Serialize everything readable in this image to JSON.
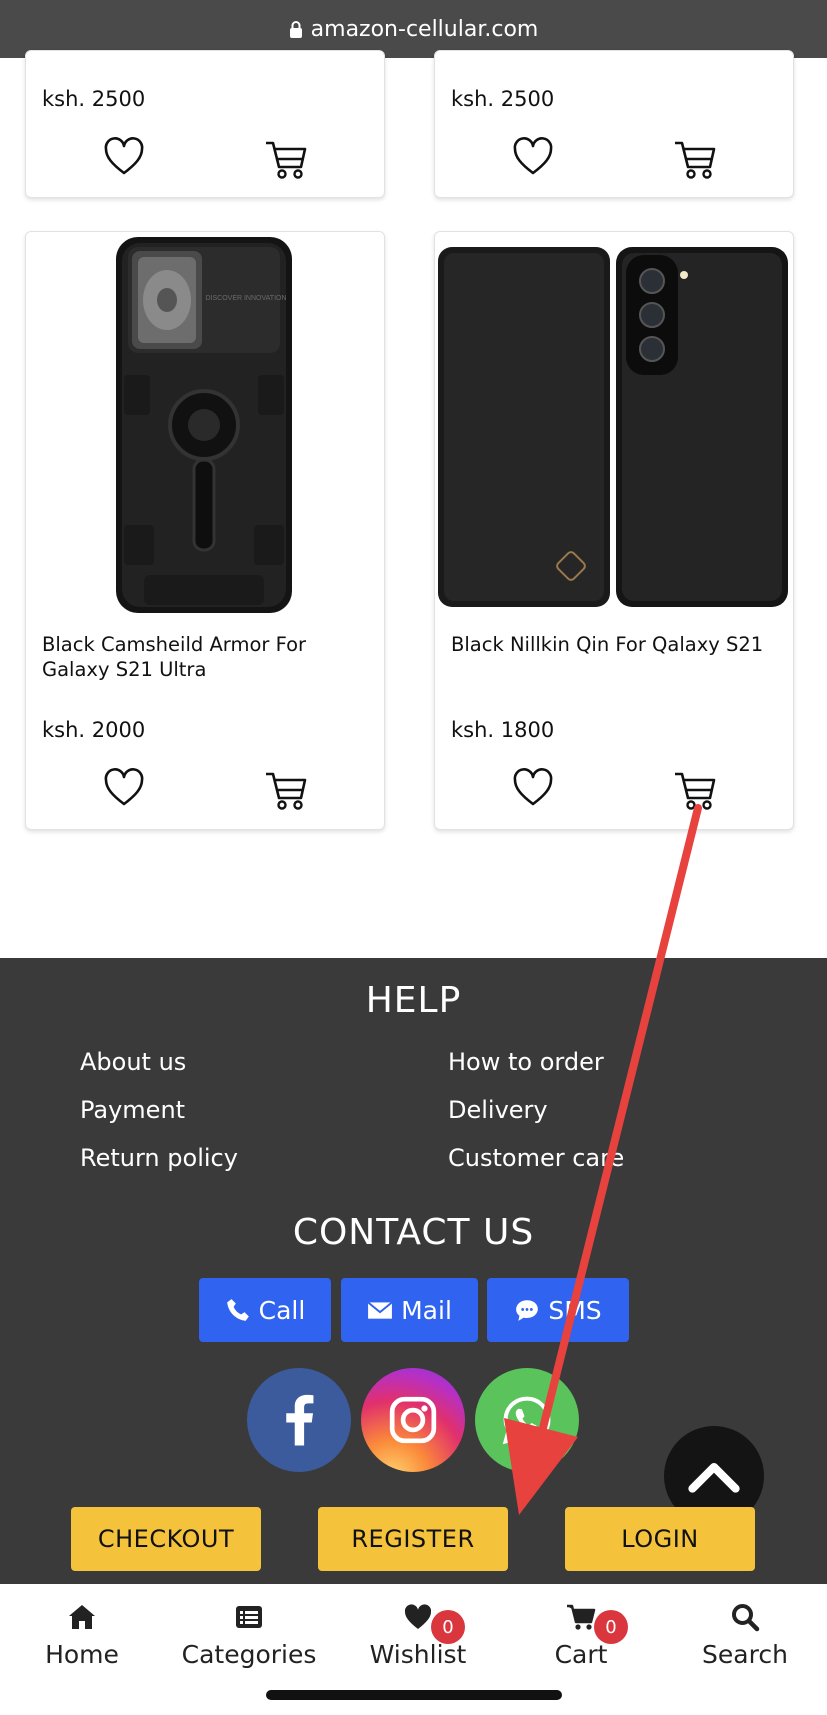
{
  "browser": {
    "url": "amazon-cellular.com"
  },
  "products": [
    {
      "name": "",
      "price": "ksh. 2500"
    },
    {
      "name": "",
      "price": "ksh. 2500"
    },
    {
      "name": "Black Camsheild Armor For Galaxy S21 Ultra",
      "price": "ksh. 2000",
      "image_text": "DISCOVER INNOVATION"
    },
    {
      "name": "Black Nillkin Qin For Qalaxy S21",
      "price": "ksh. 1800"
    }
  ],
  "footer": {
    "help_title": "HELP",
    "help_links": [
      "About us",
      "How to order",
      "Payment",
      "Delivery",
      "Return policy",
      "Customer care"
    ],
    "contact_title": "CONTACT US",
    "contact_buttons": [
      "Call",
      "Mail",
      "SMS"
    ],
    "socials": [
      "facebook",
      "instagram",
      "whatsapp"
    ],
    "actions": [
      "CHECKOUT",
      "REGISTER",
      "LOGIN"
    ]
  },
  "bottom_nav": [
    {
      "label": "Home",
      "icon": "home-icon"
    },
    {
      "label": "Categories",
      "icon": "list-icon"
    },
    {
      "label": "Wishlist",
      "icon": "heart-icon",
      "badge": "0"
    },
    {
      "label": "Cart",
      "icon": "cart-icon",
      "badge": "0"
    },
    {
      "label": "Search",
      "icon": "search-icon"
    }
  ],
  "colors": {
    "footer_bg": "#3a3a3a",
    "contact_button": "#2f63f0",
    "action_button": "#f4c33b",
    "badge": "#d9363e",
    "annotation_arrow": "#e8423f"
  }
}
